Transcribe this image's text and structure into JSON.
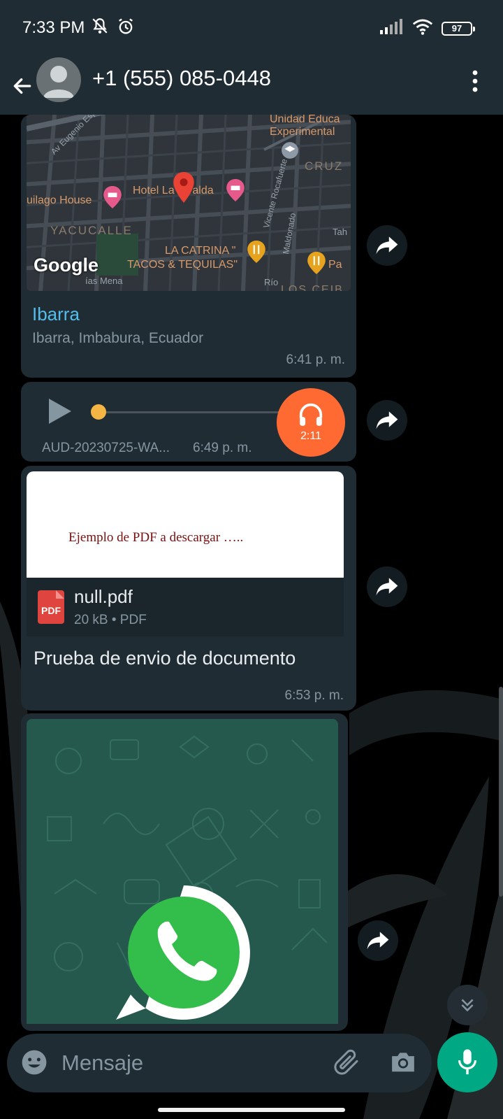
{
  "status_bar": {
    "time": "7:33 PM",
    "battery": "97",
    "icons": [
      "mute-icon",
      "alarm-icon",
      "signal-icon",
      "wifi-icon",
      "battery-icon"
    ]
  },
  "header": {
    "contact": "+1 (555) 085-0448",
    "icons": [
      "back-arrow-icon",
      "avatar-icon",
      "more-vert-icon"
    ]
  },
  "messages": {
    "location": {
      "map_labels": {
        "school": "Unidad Educa",
        "school2": "Experimental",
        "cruz": "CRUZ",
        "street1": "Av Eugenio Espejo",
        "hotel": "Hotel La Giralda",
        "house": "uilago House",
        "yacucalle": "YACUCALLE",
        "street2": "Vicente Rocafuerte",
        "street3": "Maldonado",
        "catrina1": "LA CATRINA \"",
        "catrina2": "TACOS & TEQUILAS\"",
        "pa": "Pa",
        "tah": "Tah",
        "mena": "ías Mena",
        "google": "Google",
        "ceib": "LOS CEIB",
        "rio": "Río"
      },
      "name": "Ibarra",
      "address": "Ibarra, Imbabura, Ecuador",
      "time": "6:41 p. m."
    },
    "audio": {
      "filename": "AUD-20230725-WA...",
      "time": "6:49 p. m.",
      "duration": "2:11",
      "progress_fraction": 0.0
    },
    "document": {
      "preview_text": "Ejemplo de PDF a descargar …..",
      "icon_label": "PDF",
      "filename": "null.pdf",
      "meta": "20 kB • PDF",
      "caption": "Prueba de envio de documento",
      "time": "6:53 p. m."
    },
    "image": {
      "description_icon": "whatsapp-logo"
    }
  },
  "composer": {
    "placeholder": "Mensaje"
  },
  "colors": {
    "header_bg": "#1f2c34",
    "bubble_bg": "#1f2c34",
    "link": "#53bdeb",
    "muted": "#8696a0",
    "mic": "#00a884",
    "audio_badge": "#ff6a33",
    "audio_knob": "#f5b544"
  }
}
